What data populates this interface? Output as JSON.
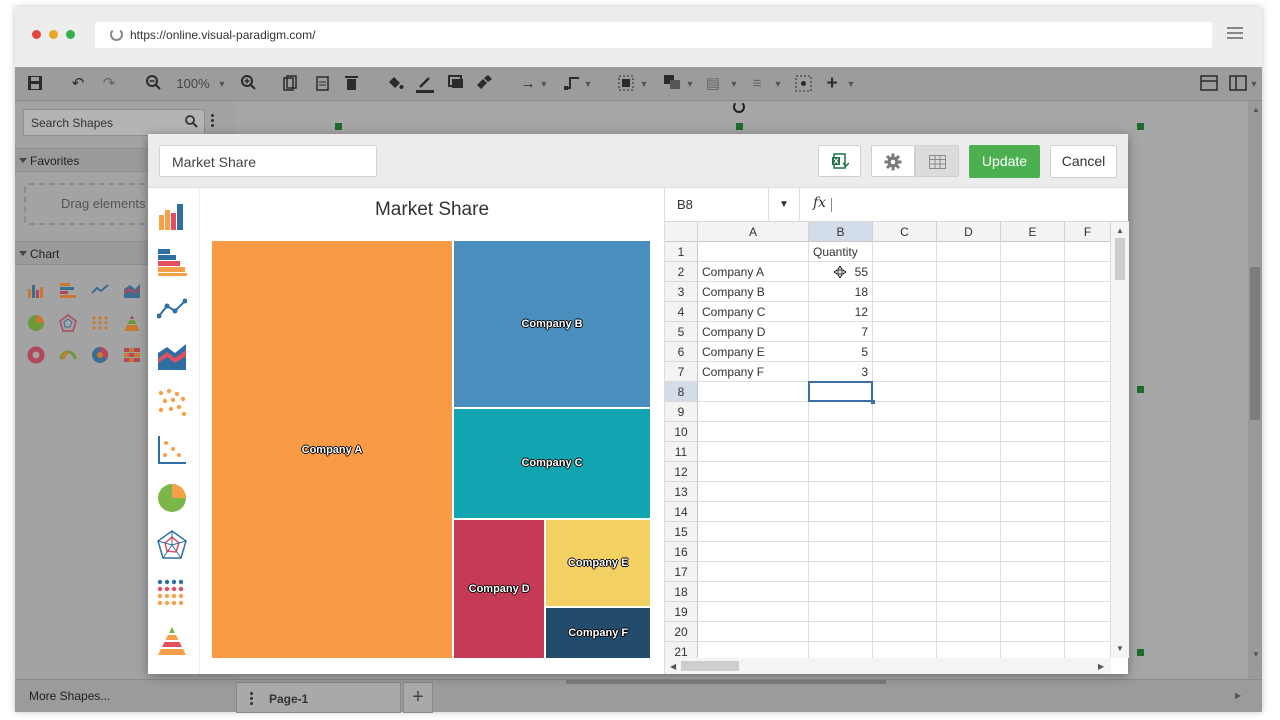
{
  "browser": {
    "url": "https://online.visual-paradigm.com/"
  },
  "toolbar": {
    "zoom": "100%"
  },
  "sidebar": {
    "search_placeholder": "Search Shapes",
    "favorites_label": "Favorites",
    "drop_hint": "Drag elements",
    "chart_label": "Chart",
    "more_shapes": "More Shapes..."
  },
  "page_tab": {
    "label": "Page-1"
  },
  "dialog": {
    "title_value": "Market Share",
    "update_label": "Update",
    "cancel_label": "Cancel"
  },
  "chart_data": {
    "type": "treemap",
    "title": "Market Share",
    "categories": [
      "Company A",
      "Company B",
      "Company C",
      "Company D",
      "Company E",
      "Company F"
    ],
    "values": [
      55,
      18,
      12,
      7,
      5,
      3
    ],
    "colors": [
      "#fa9a44",
      "#4a8ebd",
      "#11a5b2",
      "#c53a55",
      "#f3d062",
      "#234b6b"
    ],
    "series": [
      {
        "name": "Quantity",
        "values": [
          55,
          18,
          12,
          7,
          5,
          3
        ]
      }
    ]
  },
  "sheet": {
    "cell_ref": "B8",
    "columns": [
      "A",
      "B",
      "C",
      "D",
      "E",
      "F"
    ],
    "rows": [
      "1",
      "2",
      "3",
      "4",
      "5",
      "6",
      "7",
      "8",
      "9",
      "10",
      "11",
      "12",
      "13",
      "14",
      "15",
      "16",
      "17",
      "18",
      "19",
      "20",
      "21"
    ],
    "header_b1": "Quantity",
    "data": [
      [
        "Company A",
        "55"
      ],
      [
        "Company B",
        "18"
      ],
      [
        "Company C",
        "12"
      ],
      [
        "Company D",
        "7"
      ],
      [
        "Company E",
        "5"
      ],
      [
        "Company F",
        "3"
      ]
    ]
  }
}
